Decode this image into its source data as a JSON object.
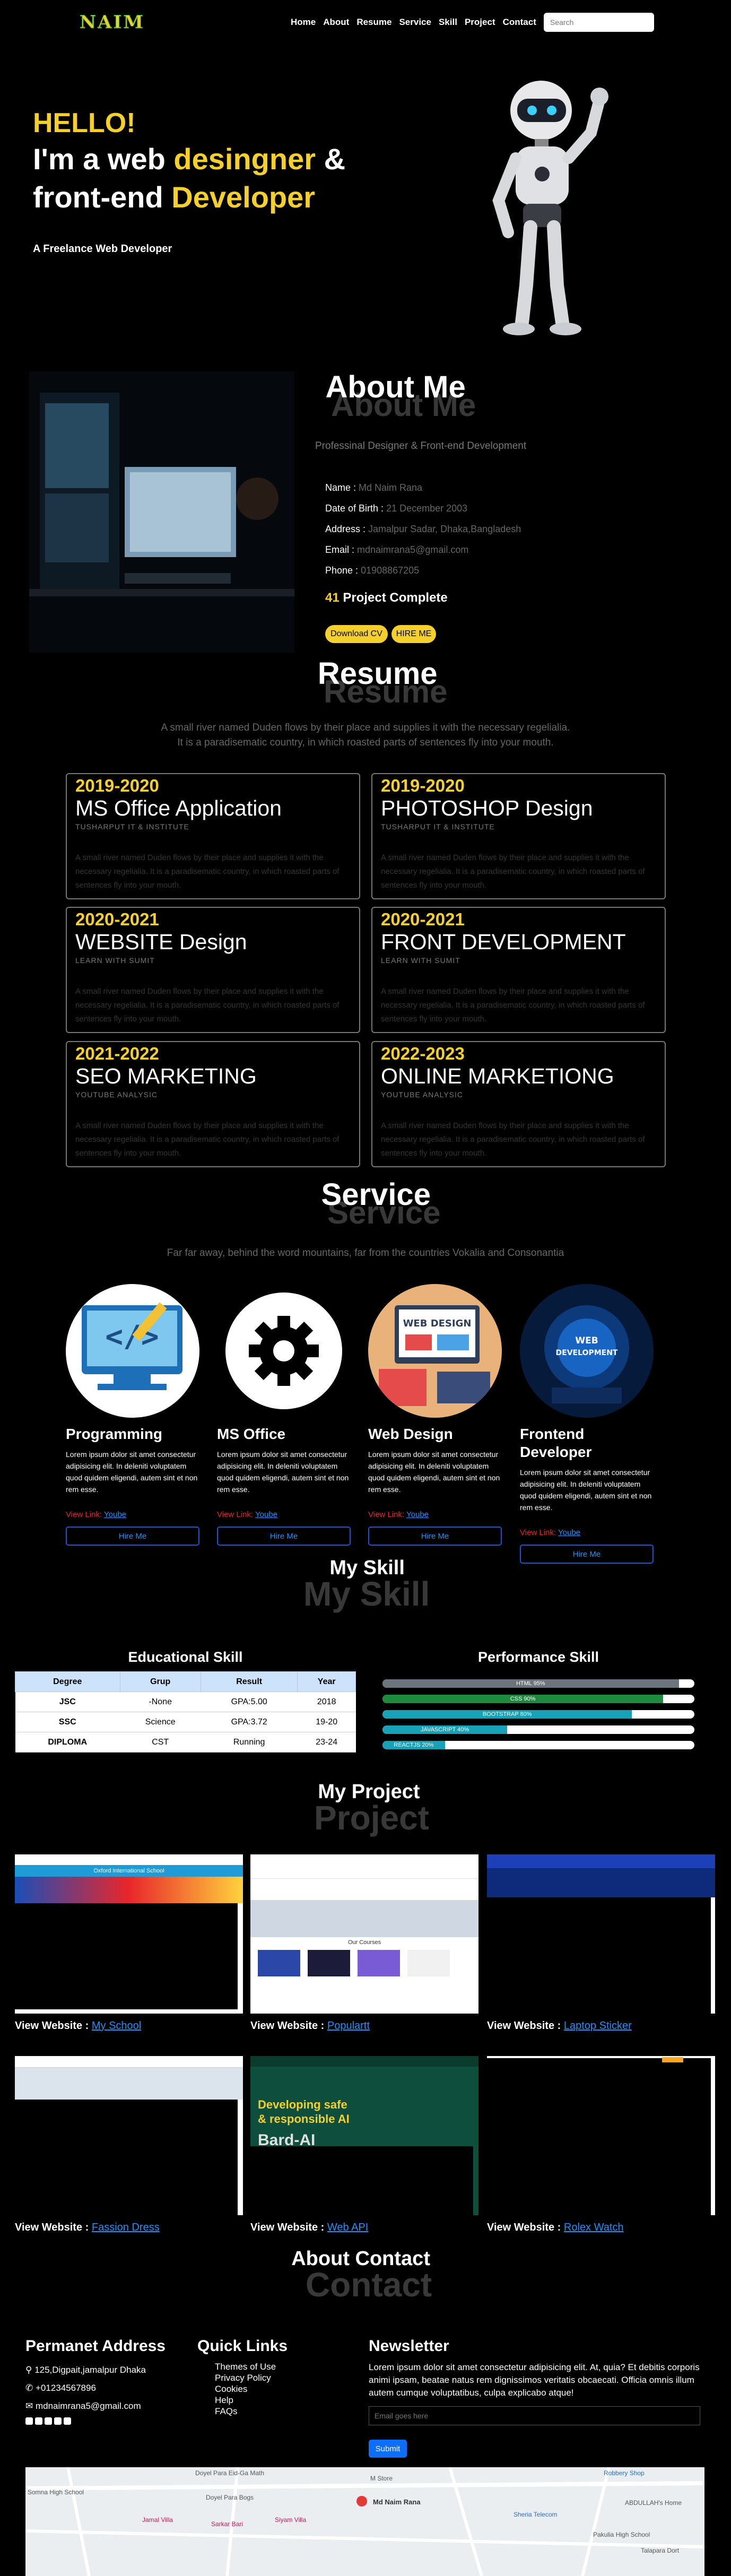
{
  "nav": {
    "logo": "NAIM",
    "items": [
      "Home",
      "About",
      "Resume",
      "Service",
      "Skill",
      "Project",
      "Contact"
    ],
    "search_placeholder": "Search"
  },
  "hero": {
    "hello": "HELLO!",
    "line2_a": "I'm a web ",
    "line2_b": "desingner",
    "line2_c": " &",
    "line3_a": "front-end ",
    "line3_b": "Developer",
    "tagline": "A Freelance Web Developer"
  },
  "about": {
    "title": "About Me",
    "title_shadow": "About Me",
    "subtitle": "Professinal Designer & Front-end Development",
    "fields": [
      {
        "label": "Name : ",
        "value": "Md Naim Rana"
      },
      {
        "label": "Date of Birth : ",
        "value": "21 December 2003"
      },
      {
        "label": "Address : ",
        "value": "Jamalpur Sadar, Dhaka,Bangladesh"
      },
      {
        "label": "Email : ",
        "value": "mdnaimrana5@gmail.com"
      },
      {
        "label": "Phone : ",
        "value": "01908867205"
      }
    ],
    "projects_num": "41",
    "projects_text": " Project Complete",
    "btn_cv": "Download CV",
    "btn_hire": "HIRE ME"
  },
  "resume": {
    "title": "Resume",
    "title_shadow": "Resume",
    "desc1": "A small river named Duden flows by their place and supplies it with the necessary regelialia.",
    "desc2": "It is a paradisematic country, in which roasted parts of sentences fly into your mouth.",
    "items": [
      {
        "year": "2019-2020",
        "title": "MS Office Application",
        "org": "TUSHARPUT IT & INSTITUTE",
        "body": "A small river named Duden flows by their place and supplies it with the necessary regelialia. It is a paradisematic country, in which roasted parts of sentences fly into your mouth."
      },
      {
        "year": "2019-2020",
        "title": "PHOTOSHOP Design",
        "org": "TUSHARPUT IT & INSTITUTE",
        "body": "A small river named Duden flows by their place and supplies it with the necessary regelialia. It is a paradisematic country, in which roasted parts of sentences fly into your mouth."
      },
      {
        "year": "2020-2021",
        "title": "WEBSITE Design",
        "org": "LEARN WITH SUMIT",
        "body": "A small river named Duden flows by their place and supplies it with the necessary regelialia. It is a paradisematic country, in which roasted parts of sentences fly into your mouth."
      },
      {
        "year": "2020-2021",
        "title": "FRONT DEVELOPMENT",
        "org": "LEARN WITH SUMIT",
        "body": "A small river named Duden flows by their place and supplies it with the necessary regelialia. It is a paradisematic country, in which roasted parts of sentences fly into your mouth."
      },
      {
        "year": "2021-2022",
        "title": "SEO MARKETING",
        "org": "YOUTUBE ANALYSIC",
        "body": "A small river named Duden flows by their place and supplies it with the necessary regelialia. It is a paradisematic country, in which roasted parts of sentences fly into your mouth."
      },
      {
        "year": "2022-2023",
        "title": "ONLINE MARKETIONG",
        "org": "YOUTUBE ANALYSIC",
        "body": "A small river named Duden flows by their place and supplies it with the necessary regelialia. It is a paradisematic country, in which roasted parts of sentences fly into your mouth."
      }
    ]
  },
  "service": {
    "title": "Service",
    "title_shadow": "Service",
    "desc": "Far far away, behind the word mountains, far from the countries Vokalia and Consonantia",
    "items": [
      {
        "title": "Programming",
        "body": "Lorem ipsum dolor sit amet consectetur adipisicing elit. In deleniti voluptatem quod quidem eligendi, autem sint et non rem esse.",
        "view": "View Link: ",
        "link": "Yoube",
        "btn": "Hire Me"
      },
      {
        "title": "MS Office",
        "body": "Lorem ipsum dolor sit amet consectetur adipisicing elit. In deleniti voluptatem quod quidem eligendi, autem sint et non rem esse.",
        "view": "View Link: ",
        "link": "Yoube",
        "btn": "Hire Me"
      },
      {
        "title": "Web Design",
        "body": "Lorem ipsum dolor sit amet consectetur adipisicing elit. In deleniti voluptatem quod quidem eligendi, autem sint et non rem esse.",
        "view": "View Link: ",
        "link": "Yoube",
        "btn": "Hire Me"
      },
      {
        "title": "Frontend Developer",
        "body": "Lorem ipsum dolor sit amet consectetur adipisicing elit. In deleniti voluptatem quod quidem eligendi, autem sint et non rem esse.",
        "view": "View Link: ",
        "link": "Yoube",
        "btn": "Hire Me"
      }
    ]
  },
  "skill": {
    "title": "My Skill",
    "title_shadow": "My Skill",
    "edu_title": "Educational Skill",
    "perf_title": "Performance Skill",
    "edu_headers": [
      "Degree",
      "Grup",
      "Result",
      "Year"
    ],
    "edu_rows": [
      [
        "JSC",
        "-None",
        "GPA:5.00",
        "2018"
      ],
      [
        "SSC",
        "Science",
        "GPA:3.72",
        "19-20"
      ],
      [
        "DIPLOMA",
        "CST",
        "Running",
        "23-24"
      ]
    ],
    "bars": [
      {
        "label": "HTML 95%",
        "pct": 95,
        "color": "#6c757d"
      },
      {
        "label": "CSS 90%",
        "pct": 90,
        "color": "#1d8a3e"
      },
      {
        "label": "BOOTSTRAP 80%",
        "pct": 80,
        "color": "#17a2b8"
      },
      {
        "label": "JAVASCRIPT 40%",
        "pct": 40,
        "color": "#17a2b8"
      },
      {
        "label": "REACTJS 20%",
        "pct": 20,
        "color": "#17a2b8"
      }
    ]
  },
  "project": {
    "title": "My Project",
    "title_shadow": "Project",
    "view_label": "View Website : ",
    "items": [
      {
        "link": "My School",
        "heading": "Oxford International School"
      },
      {
        "link": "Populartt",
        "heading": "Our Courses"
      },
      {
        "link": "Laptop Sticker",
        "heading": ""
      },
      {
        "link": "Fassion Dress",
        "heading": ""
      },
      {
        "link": "Web API",
        "heading": "Developing safe & responsible AI",
        "heading2": "Bard-AI"
      },
      {
        "link": "Rolex Watch",
        "heading": ""
      }
    ]
  },
  "contact": {
    "title": "About Contact",
    "title_shadow": "Contact"
  },
  "footer": {
    "addr_title": "Permanet Address",
    "addr_lines": [
      "125,Digpait,jamalpur Dhaka",
      "+01234567896",
      "mdnaimrana5@gmail.com"
    ],
    "quick_title": "Quick Links",
    "quick_items": [
      "Themes of Use",
      "Privacy Policy",
      "Cookies",
      "Help",
      "FAQs"
    ],
    "news_title": "Newsletter",
    "news_body": "Lorem ipsum dolor sit amet consectetur adipisicing elit. At, quia? Et debitis corporis animi ipsam, beatae natus rem dignissimos veritatis obcaecati. Officia omnis illum autem cumque voluptatibus, culpa explicabo atque!",
    "email_placeholder": "Email goes here",
    "submit": "Submit"
  },
  "map": {
    "labels": [
      "Doyel Para Eid-Ga Math",
      "M Store",
      "Robbery Shop",
      "Somna High School",
      "Doyel Para Bogs",
      "Md Naim Rana",
      "Jamal Villa",
      "Sarkar Bari",
      "Siyam Villa",
      "Sheria Telecom",
      "ABDULLAH's Home",
      "Pakulia High School",
      "Talapara Dort"
    ]
  },
  "colors": {
    "accent": "#f5d02a",
    "link": "#1e90ff",
    "button_border": "#1a55d6"
  }
}
